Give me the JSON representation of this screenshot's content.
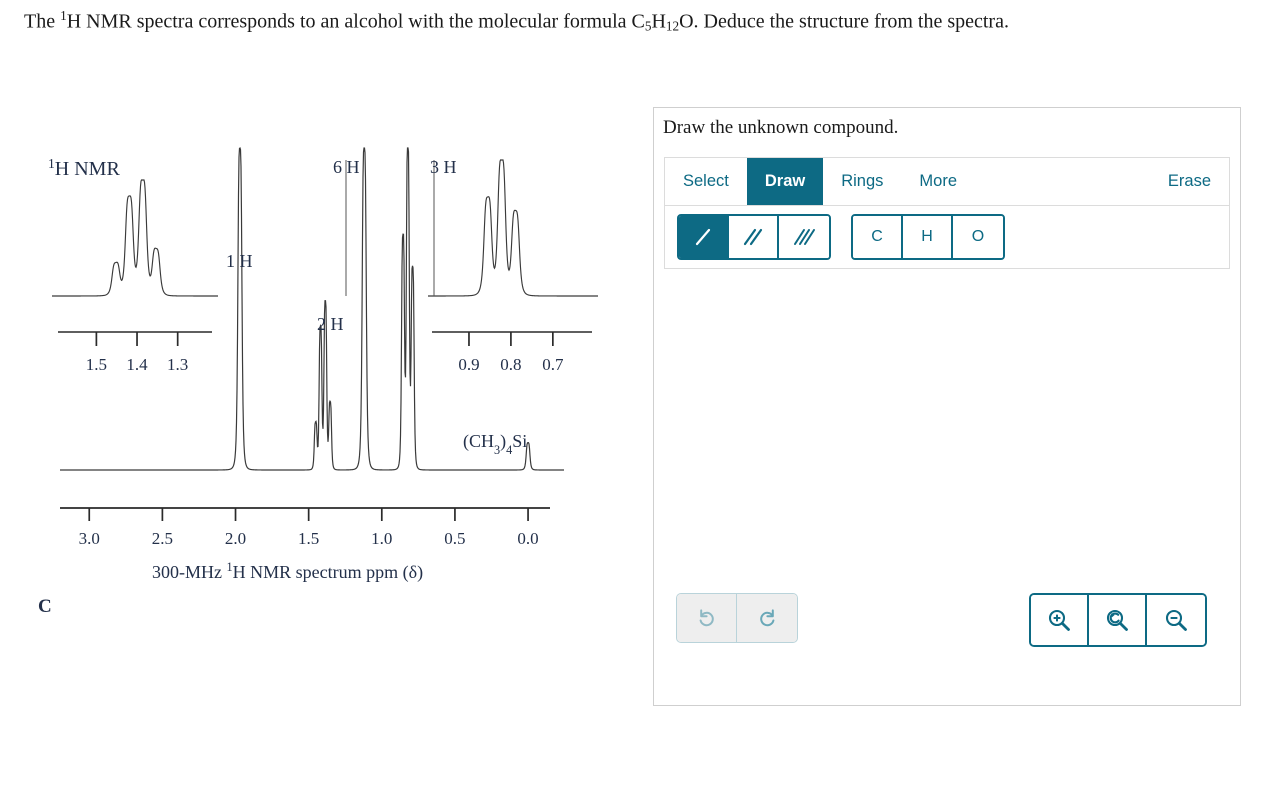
{
  "question": {
    "text_parts": [
      {
        "t": "The "
      },
      {
        "t": "1",
        "sup": true
      },
      {
        "t": "H NMR spectra corresponds to an alcohol with the molecular formula C"
      },
      {
        "t": "5",
        "sub": true
      },
      {
        "t": "H"
      },
      {
        "t": "12",
        "sub": true
      },
      {
        "t": "O. Deduce the structure from the spectra."
      }
    ],
    "plain": "The 1H NMR spectra corresponds to an alcohol with the molecular formula C5H12O. Deduce the structure from the spectra."
  },
  "figure": {
    "title": "1H NMR",
    "title_sup": "1",
    "title_rest": "H NMR",
    "caption": "300-MHz 1H NMR spectrum ppm (δ)",
    "caption_pre": "300-MHz ",
    "caption_sup": "1",
    "caption_post": "H NMR spectrum ppm (δ)",
    "panel_letter": "C",
    "tms_label": "(CH3)4Si",
    "tms_parts": [
      {
        "t": "(CH"
      },
      {
        "t": "3",
        "sub": true
      },
      {
        "t": ")"
      },
      {
        "t": "4",
        "sub": true
      },
      {
        "t": "Si"
      }
    ],
    "integration_labels": [
      {
        "name": "1 H",
        "ppm": 2.0
      },
      {
        "name": "2 H",
        "ppm": 1.4
      },
      {
        "name": "6 H",
        "ppm": 1.12
      },
      {
        "name": "3 H",
        "ppm": 0.82
      }
    ]
  },
  "chart_data": {
    "type": "line",
    "title": "1H NMR",
    "xlabel": "300-MHz 1H NMR spectrum ppm (δ)",
    "ylabel": "",
    "xlim": [
      3.2,
      -0.15
    ],
    "axis_ticks": [
      "3.0",
      "2.5",
      "2.0",
      "1.5",
      "1.0",
      "0.5",
      "0.0"
    ],
    "axis_tick_values": [
      3.0,
      2.5,
      2.0,
      1.5,
      1.0,
      0.5,
      0.0
    ],
    "grid": false,
    "legend": "none",
    "peaks": [
      {
        "label": "1 H",
        "ppm": 1.97,
        "height": 1.0,
        "multiplicity": "singlet (OH)",
        "integration": 1
      },
      {
        "label": "2 H",
        "ppm": 1.4,
        "height": 0.52,
        "multiplicity": "quartet",
        "integration": 2
      },
      {
        "label": "6 H",
        "ppm": 1.12,
        "height": 1.0,
        "multiplicity": "singlet",
        "integration": 6
      },
      {
        "label": "3 H",
        "ppm": 0.83,
        "height": 1.0,
        "multiplicity": "triplet",
        "integration": 3
      },
      {
        "label": "(CH3)4Si",
        "ppm": 0.0,
        "height": 0.08,
        "multiplicity": "singlet",
        "integration": 0
      }
    ],
    "insets": [
      {
        "name": "left-inset",
        "label": "2 H",
        "xlim": [
          1.56,
          1.25
        ],
        "ticks": [
          "1.5",
          "1.4",
          "1.3"
        ],
        "tick_values": [
          1.5,
          1.4,
          1.3
        ],
        "multiplicity": "quartet",
        "lines": [
          {
            "ppm": 1.452,
            "rel_height": 0.28
          },
          {
            "ppm": 1.419,
            "rel_height": 0.85
          },
          {
            "ppm": 1.386,
            "rel_height": 1.0
          },
          {
            "ppm": 1.353,
            "rel_height": 0.4
          }
        ]
      },
      {
        "name": "right-inset",
        "label": "3 H",
        "xlim": [
          0.95,
          0.64
        ],
        "ticks": [
          "0.9",
          "0.8",
          "0.7"
        ],
        "tick_values": [
          0.9,
          0.8,
          0.7
        ],
        "multiplicity": "triplet",
        "lines": [
          {
            "ppm": 0.855,
            "rel_height": 0.72
          },
          {
            "ppm": 0.822,
            "rel_height": 1.0
          },
          {
            "ppm": 0.789,
            "rel_height": 0.62
          }
        ]
      }
    ]
  },
  "draw_panel": {
    "title": "Draw the unknown compound.",
    "tabs": [
      {
        "label": "Select",
        "active": false
      },
      {
        "label": "Draw",
        "active": true
      },
      {
        "label": "Rings",
        "active": false
      },
      {
        "label": "More",
        "active": false
      }
    ],
    "erase_label": "Erase",
    "bond_buttons": [
      {
        "name": "single-bond",
        "icon": "single-bond-icon",
        "selected": true
      },
      {
        "name": "double-bond",
        "icon": "double-bond-icon",
        "selected": false
      },
      {
        "name": "triple-bond",
        "icon": "triple-bond-icon",
        "selected": false
      }
    ],
    "element_buttons": [
      {
        "label": "C",
        "name": "element-carbon"
      },
      {
        "label": "H",
        "name": "element-hydrogen"
      },
      {
        "label": "O",
        "name": "element-oxygen"
      }
    ],
    "history_buttons": [
      {
        "name": "undo-button",
        "icon": "undo-icon"
      },
      {
        "name": "redo-button",
        "icon": "redo-icon"
      }
    ],
    "zoom_buttons": [
      {
        "name": "zoom-in-button",
        "icon": "zoom-in-icon"
      },
      {
        "name": "zoom-reset-button",
        "icon": "zoom-reset-icon"
      },
      {
        "name": "zoom-out-button",
        "icon": "zoom-out-icon"
      }
    ],
    "canvas_content": ""
  },
  "colors": {
    "accent_teal": "#0d6a84",
    "panel_border": "#cfcfcf",
    "tool_border": "#dcdcdc",
    "disabled_bg": "#eeeeee",
    "disabled_border": "#b9d3da",
    "label_ink": "#23304a",
    "trace_ink": "#3a3a3a"
  }
}
